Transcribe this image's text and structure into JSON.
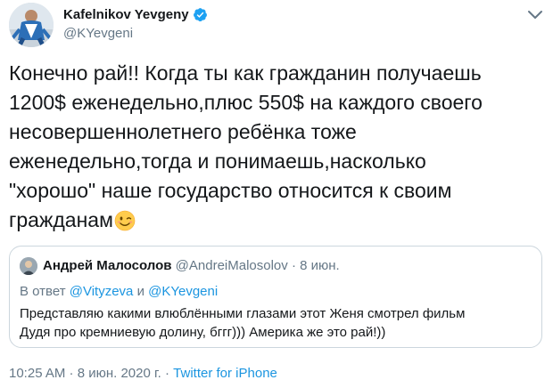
{
  "author": {
    "display_name": "Kafelnikov Yevgeny",
    "handle": "@KYevgeni",
    "verified": true,
    "avatar_icon": "profile-photo-avatar",
    "verified_icon": "verified-badge-icon",
    "menu_icon": "chevron-down-icon"
  },
  "tweet": {
    "text": "Конечно рай!! Когда ты как гражданин получаешь\n1200$ еженедельно,плюс 550$ на каждого своего\nнесовершеннолетнего ребёнка тоже\nеженедельно,тогда и понимаешь,насколько\n\"хорошо\" наше государство относится к своим\nгражданам",
    "emoji": "winking-face-emoji"
  },
  "quoted_tweet": {
    "avatar_icon": "profile-photo-avatar",
    "display_name": "Андрей Малосолов",
    "handle": "@AndreiMalosolov",
    "separator": "·",
    "date": "8 июн.",
    "reply_prefix": "В ответ",
    "reply_mention_1": "@Vityzeva",
    "reply_conjunction": "и",
    "reply_mention_2": "@KYevgeni",
    "text": "Представляю какими влюблёнными глазами этот Женя смотрел фильм\nДудя про кремниевую долину, бггг))) Америка же это рай!))"
  },
  "meta": {
    "timestamp": "10:25 AM · 8 июн. 2020 г.",
    "separator": "·",
    "source": "Twitter for iPhone"
  },
  "colors": {
    "link": "#1b95e0",
    "secondary_text": "#657786",
    "primary_text": "#14171a",
    "border": "#ccd6dd"
  }
}
